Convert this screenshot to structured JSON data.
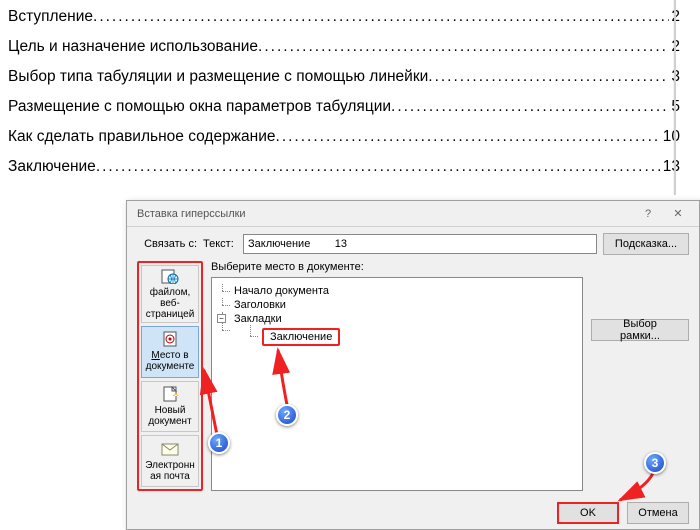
{
  "toc": [
    {
      "title": "Вступление",
      "page": "2"
    },
    {
      "title": "Цель и назначение использование ",
      "page": "2"
    },
    {
      "title": "Выбор типа табуляции и размещение с помощью линейки",
      "page": "3"
    },
    {
      "title": "Размещение с помощью окна параметров табуляции ",
      "page": "5"
    },
    {
      "title": "Как сделать правильное содержание",
      "page": "10"
    },
    {
      "title": "Заключение ",
      "page": "13"
    }
  ],
  "dialog": {
    "title": "Вставка гиперссылки",
    "link_with_label": "Связать с:",
    "text_label": "Текст:",
    "text_value": "Заключение        13",
    "tooltip_btn": "Подсказка...",
    "select_place_label": "Выберите место в документе:",
    "frame_btn": "Выбор рамки...",
    "ok": "OK",
    "cancel": "Отмена"
  },
  "link_targets": {
    "file_web": "файлом, веб-страницей",
    "place": "Место в документе",
    "new_doc": "Новый документ",
    "email": "Электронная почта"
  },
  "tree": {
    "top": "Начало документа",
    "headings": "Заголовки",
    "bookmarks": "Закладки",
    "bookmark_item": "Заключение"
  },
  "annotations": {
    "1": "1",
    "2": "2",
    "3": "3"
  }
}
